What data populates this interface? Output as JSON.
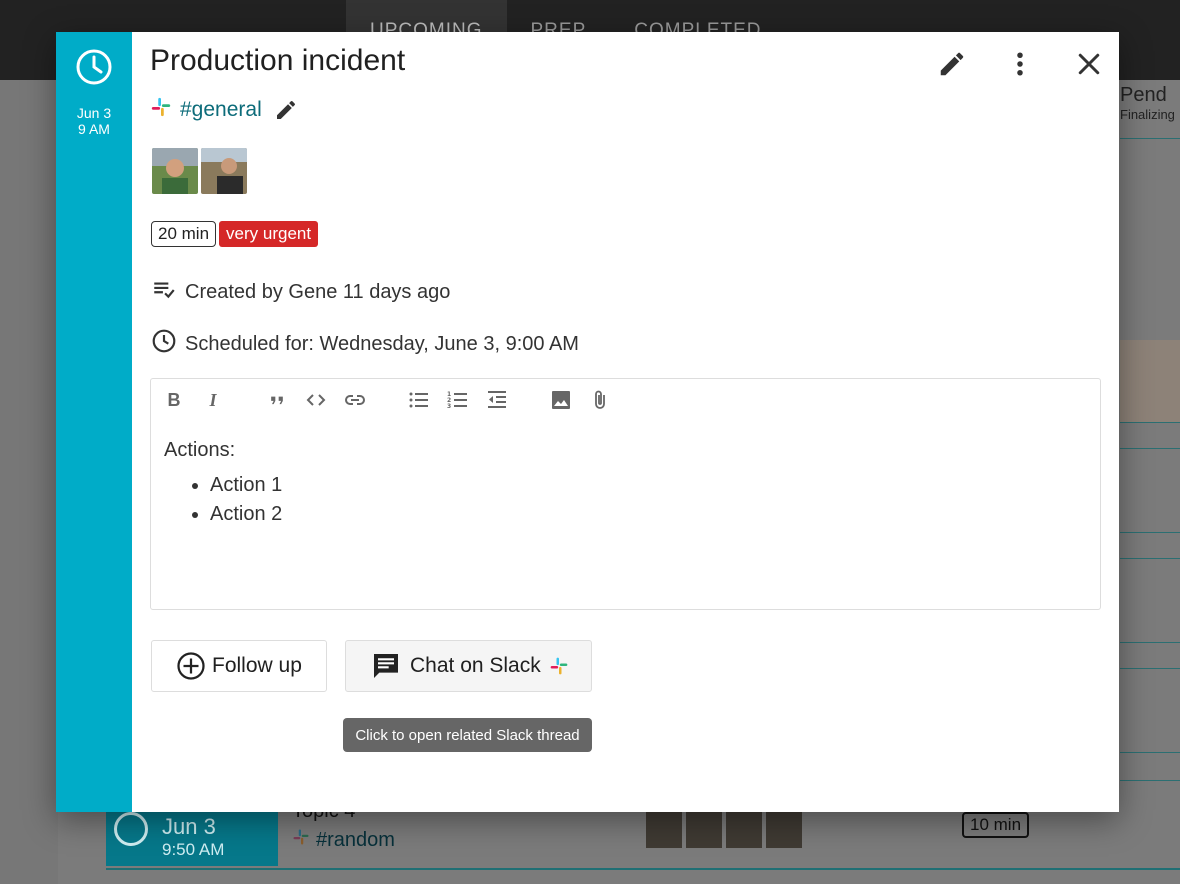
{
  "background": {
    "tabs": [
      "UPCOMING",
      "PREP",
      "COMPLETED"
    ],
    "pending_title": "Pend",
    "pending_sub": "Finalizing",
    "row": {
      "date": "Jun 3",
      "time": "9:50 AM",
      "topic": "Topic 4",
      "channel": "#random",
      "duration": "10 min"
    }
  },
  "modal": {
    "date": "Jun 3",
    "time": "9 AM",
    "title": "Production incident",
    "channel": "#general",
    "duration": "20 min",
    "urgency": "very urgent",
    "created": "Created by Gene 11 days ago",
    "scheduled": "Scheduled for: Wednesday, June 3, 9:00 AM",
    "notes": {
      "heading": "Actions:",
      "items": [
        "Action 1",
        "Action 2"
      ]
    },
    "follow_up_label": "Follow up",
    "slack_label": "Chat on Slack",
    "tooltip": "Click to open related Slack thread"
  },
  "colors": {
    "accent": "#00acc8",
    "urgent": "#d52828",
    "channel": "#0d6c7a"
  }
}
